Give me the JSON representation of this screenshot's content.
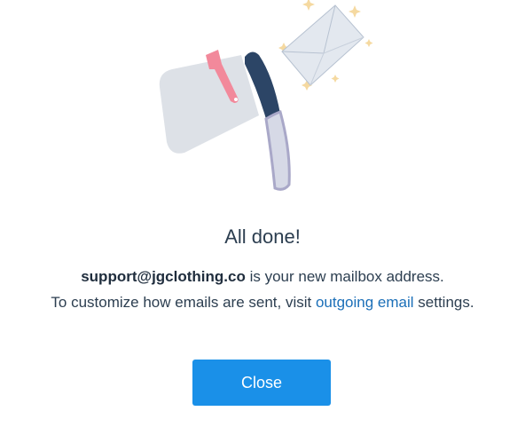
{
  "dialog": {
    "title": "All done!",
    "address": "support@jgclothing.co",
    "address_suffix": " is your new mailbox address.",
    "line2_prefix": "To customize how emails are sent, visit ",
    "link_text": "outgoing email",
    "line2_suffix": " settings.",
    "close_label": "Close"
  },
  "colors": {
    "button": "#1a90e8",
    "link": "#1b6fb8",
    "mailbox_body": "#dde1e7",
    "mailbox_door": "#2c4566",
    "flag": "#f2899b",
    "envelope": "#e3e8ef",
    "sparkle": "#f5d9a0"
  }
}
